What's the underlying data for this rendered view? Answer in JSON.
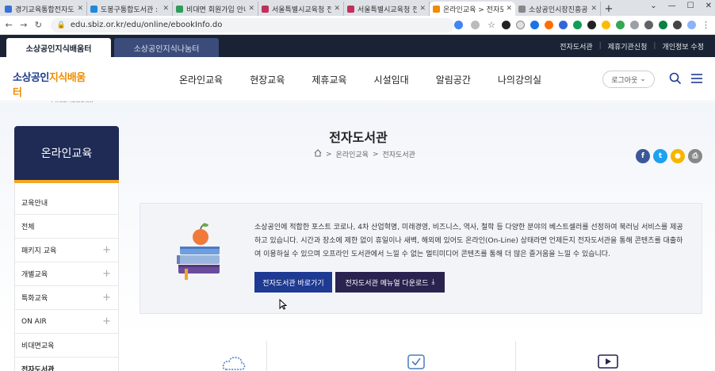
{
  "browser": {
    "tabs": [
      {
        "title": "경기교육통합전자도서관",
        "fav": "#3b6fd8",
        "active": false
      },
      {
        "title": "도봉구통합도서관 : L",
        "fav": "#1f8ad8",
        "active": false
      },
      {
        "title": "비대면 회원가입 안내",
        "fav": "#2e9c5a",
        "active": false
      },
      {
        "title": "서울특별시교육청 전",
        "fav": "#c0305a",
        "active": false
      },
      {
        "title": "서울특별시교육청 전",
        "fav": "#c0305a",
        "active": false
      },
      {
        "title": "온라인교육 > 전자도",
        "fav": "#f08c00",
        "active": true
      },
      {
        "title": "소상공인시장진흥공",
        "fav": "#888888",
        "active": false
      }
    ],
    "new_tab": "+",
    "url": "edu.sbiz.or.kr/edu/online/ebookInfo.do"
  },
  "site": {
    "top_tabs": {
      "tab1": "소상공인지식배움터",
      "tab2": "소상공인지식나눔터"
    },
    "top_links": {
      "ebook": "전자도서관",
      "partner": "제휴기관신청",
      "profile": "개인정보 수정"
    },
    "logo": {
      "main_a": "소상공인",
      "main_b": "지식배움터",
      "sub": "소상공인시장진흥공단"
    },
    "gnb": [
      "온라인교육",
      "현장교육",
      "제휴교육",
      "시설임대",
      "알림공간",
      "나의강의실"
    ],
    "logout": "로그아웃"
  },
  "lnb": {
    "title": "온라인교육",
    "items": [
      {
        "label": "교육안내",
        "plus": false
      },
      {
        "label": "전체",
        "plus": false
      },
      {
        "label": "패키지 교육",
        "plus": true
      },
      {
        "label": "개별교육",
        "plus": true
      },
      {
        "label": "특화교육",
        "plus": true
      },
      {
        "label": "ON AIR",
        "plus": true
      },
      {
        "label": "비대면교육",
        "plus": false
      },
      {
        "label": "전자도서관",
        "plus": false
      }
    ]
  },
  "page": {
    "title": "전자도서관",
    "breadcrumb": [
      "온라인교육",
      "전자도서관"
    ]
  },
  "intro": {
    "text": "소상공인에 적합한 포스트 코로나, 4차 산업혁명, 미래경영, 비즈니스, 역사, 철학 등 다양한 분야의 베스트셀러를 선정하여 북러닝 서비스를 제공하고 있습니다. 시간과 장소에 제한 없이 휴일이나 새벽, 해외에 있어도 온라인(On-Line) 상태라면 언제든지 전자도서관을 통해 콘텐츠를 대출하여 이용하실 수 있으며 오프라인 도서관에서 느낄 수 없는 멀티미디어 콘텐츠를 통해 더 많은 즐거움을 느낄 수 있습니다.",
    "btn_go": "전자도서관 바로가기",
    "btn_manual": "전자도서관 메뉴얼 다운로드"
  },
  "sns": [
    {
      "name": "facebook",
      "glyph": "f",
      "color": "#3b5998"
    },
    {
      "name": "twitter",
      "glyph": "t",
      "color": "#1da1f2"
    },
    {
      "name": "kakaostory",
      "glyph": "●",
      "color": "#f7b500"
    },
    {
      "name": "print",
      "glyph": "⎙",
      "color": "#888888"
    }
  ]
}
